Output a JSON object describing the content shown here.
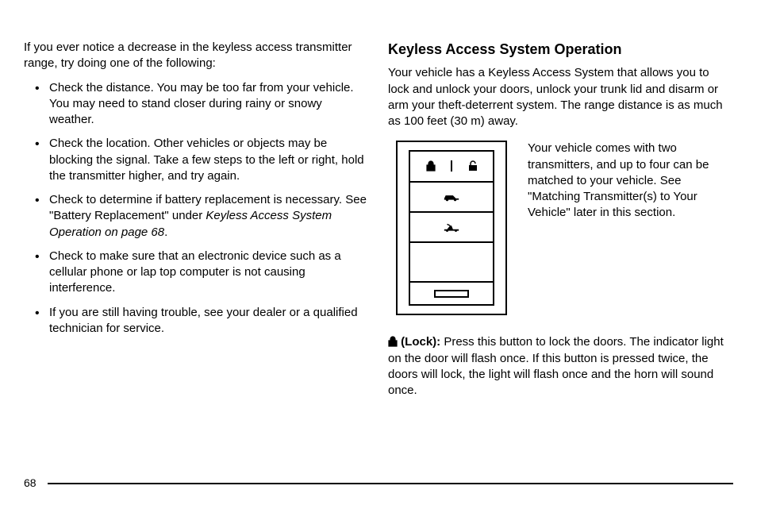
{
  "left": {
    "intro": "If you ever notice a decrease in the keyless access transmitter range, try doing one of the following:",
    "bullets": [
      "Check the distance. You may be too far from your vehicle. You may need to stand closer during rainy or snowy weather.",
      "Check the location. Other vehicles or objects may be blocking the signal. Take a few steps to the left or right, hold the transmitter higher, and try again.",
      "Check to determine if battery replacement is necessary. See \"Battery Replacement\" under ",
      "Check to make sure that an electronic device such as a cellular phone or lap top computer is not causing interference.",
      "If you are still having trouble, see your dealer or a qualified technician for service."
    ],
    "bullet3_italic": "Keyless Access System Operation on page 68",
    "bullet3_tail": "."
  },
  "right": {
    "heading": "Keyless Access System Operation",
    "intro": "Your vehicle has a Keyless Access System that allows you to lock and unlock your doors, unlock your trunk lid and disarm or arm your theft-deterrent system. The range distance is as much as 100 feet (30 m) away.",
    "figtext": "Your vehicle comes with two transmitters, and up to four can be matched to your vehicle. See \"Matching Transmitter(s) to Your Vehicle\" later in this section.",
    "lock_label": "(Lock):",
    "lock_body": "Press this button to lock the doors. The indicator light on the door will flash once. If this button is pressed twice, the doors will lock, the light will flash once and the horn will sound once."
  },
  "page_number": "68",
  "icons": {
    "lock_closed": "lock-closed-icon",
    "lock_open": "lock-open-icon",
    "car": "car-side-icon",
    "trunk": "trunk-open-icon"
  }
}
